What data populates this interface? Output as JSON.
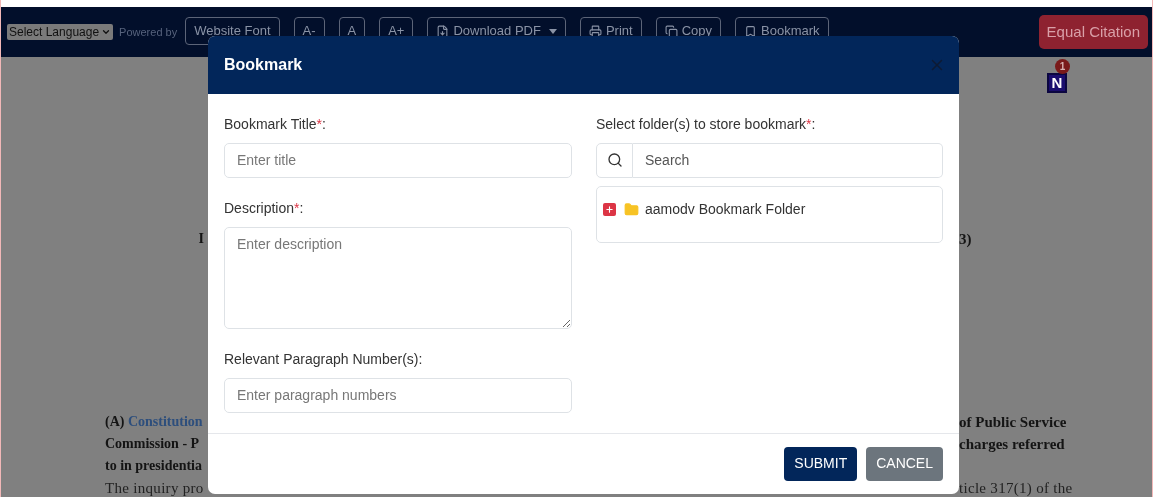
{
  "toolbar": {
    "language_select": "Select Language",
    "powered_by": "Powered by",
    "buttons": [
      {
        "label": "Website Font",
        "kind": "text"
      },
      {
        "label": "A-",
        "kind": "text"
      },
      {
        "label": "A",
        "kind": "text"
      },
      {
        "label": "A+",
        "kind": "text"
      },
      {
        "label": "Download PDF",
        "kind": "download"
      },
      {
        "label": "Print",
        "kind": "print"
      },
      {
        "label": "Copy",
        "kind": "copy"
      },
      {
        "label": "Bookmark",
        "kind": "bookmark"
      }
    ],
    "citation_button": "Equal Citation"
  },
  "notification": {
    "letter": "N",
    "count": "1"
  },
  "background_text": {
    "heading_left": "I",
    "heading_right": "3)",
    "left_lines": [
      {
        "prefix": "(A) ",
        "link": "Constitution",
        "kind": "headnote"
      },
      {
        "prefix": "Commission - P",
        "kind": "headnote"
      },
      {
        "prefix": "to in presidentia",
        "kind": "headnote"
      },
      {
        "prefix": "The inquiry pro",
        "kind": "body"
      }
    ],
    "right_lines": [
      {
        "text": "of Public Service",
        "kind": "headnote"
      },
      {
        "text": "charges referred",
        "kind": "headnote"
      },
      {
        "text": "ticle 317(1) of the",
        "kind": "body"
      }
    ]
  },
  "dialog": {
    "title": "Bookmark",
    "fields": [
      {
        "kind": "input",
        "label": "Bookmark Title",
        "required_mark": "*",
        "suffix": ":",
        "placeholder": "Enter title"
      },
      {
        "kind": "textarea",
        "label": "Description",
        "required_mark": "*",
        "suffix": ":",
        "placeholder": "Enter description"
      },
      {
        "kind": "input",
        "label": "Relevant Paragraph Number(s)",
        "suffix": ":",
        "placeholder": "Enter paragraph numbers"
      }
    ],
    "folders_label": "Select folder(s) to store bookmark",
    "folders_required_mark": "*",
    "folders_suffix": ":",
    "search_placeholder": "Search",
    "folders": [
      {
        "name": "aamodv Bookmark Folder",
        "expanded": false
      }
    ],
    "buttons": [
      {
        "label": "SUBMIT",
        "kind": "primary"
      },
      {
        "label": "CANCEL",
        "kind": "secondary"
      }
    ]
  }
}
